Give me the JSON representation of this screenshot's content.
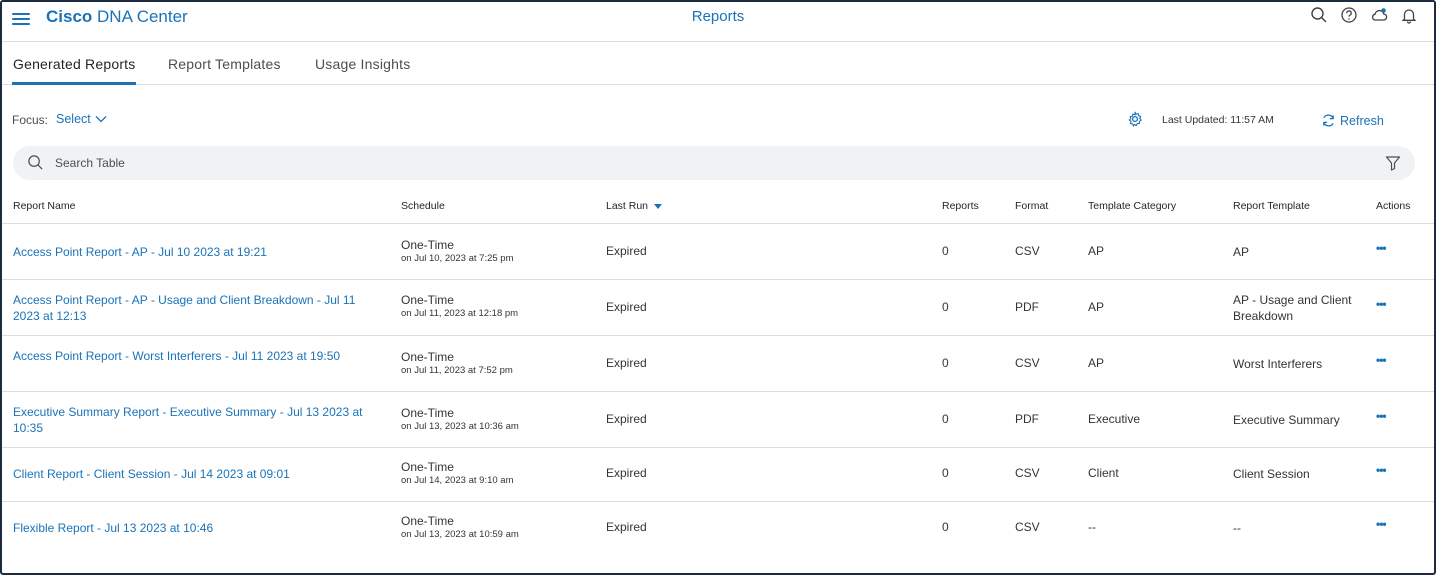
{
  "header": {
    "brand_bold": "Cisco",
    "brand_rest": " DNA Center",
    "page_title": "Reports",
    "icons": [
      "search-icon",
      "help-icon",
      "cloud-icon",
      "bell-icon"
    ]
  },
  "tabs": [
    {
      "label": "Generated Reports",
      "active": true
    },
    {
      "label": "Report Templates",
      "active": false
    },
    {
      "label": "Usage Insights",
      "active": false
    }
  ],
  "toolbar": {
    "focus_label": "Focus:",
    "focus_value": "Select",
    "last_updated": "Last Updated: 11:57 AM",
    "refresh_label": "Refresh"
  },
  "search": {
    "placeholder": "Search Table"
  },
  "table": {
    "columns": [
      "Report Name",
      "Schedule",
      "Last Run",
      "Reports",
      "Format",
      "Template Category",
      "Report Template",
      "Actions"
    ],
    "rows": [
      {
        "name": "Access Point Report - AP - Jul 10 2023 at 19:21",
        "schedule": "One-Time",
        "schedule_detail": "on Jul 10, 2023 at 7:25 pm",
        "last_run": "Expired",
        "reports": "0",
        "format": "CSV",
        "category": "AP",
        "template": "AP",
        "actions": "•••"
      },
      {
        "name": "Access Point Report - AP - Usage and Client Breakdown - Jul 11 2023 at 12:13",
        "schedule": "One-Time",
        "schedule_detail": "on Jul 11, 2023 at 12:18 pm",
        "last_run": "Expired",
        "reports": "0",
        "format": "PDF",
        "category": "AP",
        "template": "AP - Usage and Client Breakdown",
        "actions": "•••"
      },
      {
        "name": "Access Point Report - Worst Interferers - Jul 11 2023 at 19:50",
        "schedule": "One-Time",
        "schedule_detail": "on Jul 11, 2023 at 7:52 pm",
        "last_run": "Expired",
        "reports": "0",
        "format": "CSV",
        "category": "AP",
        "template": "Worst Interferers",
        "actions": "•••"
      },
      {
        "name": "Executive Summary Report - Executive Summary - Jul 13 2023 at 10:35",
        "schedule": "One-Time",
        "schedule_detail": "on Jul 13, 2023 at 10:36 am",
        "last_run": "Expired",
        "reports": "0",
        "format": "PDF",
        "category": "Executive",
        "template": "Executive Summary",
        "actions": "•••"
      },
      {
        "name": "Client Report - Client Session - Jul 14 2023 at 09:01",
        "schedule": "One-Time",
        "schedule_detail": "on Jul 14, 2023 at 9:10 am",
        "last_run": "Expired",
        "reports": "0",
        "format": "CSV",
        "category": "Client",
        "template": "Client Session",
        "actions": "•••"
      },
      {
        "name": "Flexible Report - Jul 13 2023 at 10:46",
        "schedule": "One-Time",
        "schedule_detail": "on Jul 13, 2023 at 10:59 am",
        "last_run": "Expired",
        "reports": "0",
        "format": "CSV",
        "category": "--",
        "template": "--",
        "actions": "•••"
      }
    ]
  },
  "colors": {
    "accent": "#1a73b8",
    "border": "#dadde1",
    "search_bg": "#f0f2f4"
  }
}
